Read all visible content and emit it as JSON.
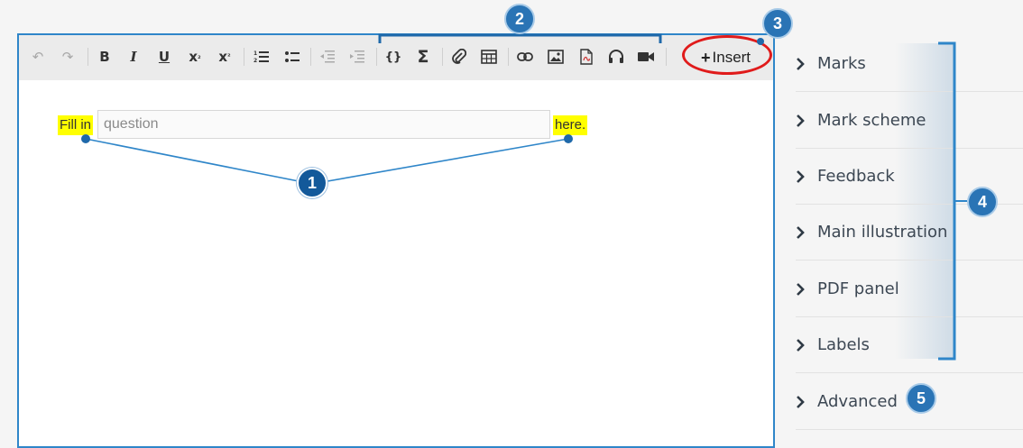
{
  "toolbar": {
    "items": [
      {
        "icon": "undo-icon",
        "glyph": "↶",
        "dim": true
      },
      {
        "icon": "redo-icon",
        "glyph": "↷",
        "dim": true
      },
      {
        "icon": "bold-icon",
        "glyph": "B"
      },
      {
        "icon": "italic-icon",
        "glyph": "I"
      },
      {
        "icon": "underline-icon",
        "glyph": "U"
      },
      {
        "icon": "subscript-icon",
        "glyph": "x₂"
      },
      {
        "icon": "superscript-icon",
        "glyph": "x²"
      },
      {
        "icon": "numbered-list-icon",
        "glyph": "⒈"
      },
      {
        "icon": "bullet-list-icon",
        "glyph": "•≡"
      },
      {
        "icon": "outdent-icon",
        "glyph": "⇤",
        "dim": true
      },
      {
        "icon": "indent-icon",
        "glyph": "⇥",
        "dim": true
      },
      {
        "icon": "code-braces-icon",
        "glyph": "{}"
      },
      {
        "icon": "sigma-icon",
        "glyph": "Σ"
      },
      {
        "icon": "paperclip-icon",
        "glyph": "📎"
      },
      {
        "icon": "table-icon",
        "glyph": "▦"
      },
      {
        "icon": "link-icon",
        "glyph": "⊂⊃"
      },
      {
        "icon": "image-icon",
        "glyph": "▨"
      },
      {
        "icon": "pdf-icon",
        "glyph": "▤"
      },
      {
        "icon": "headphones-icon",
        "glyph": "∩"
      },
      {
        "icon": "video-icon",
        "glyph": "■"
      }
    ],
    "insert_label": "Insert"
  },
  "content": {
    "before_text": "Fill in",
    "input_placeholder": "question",
    "after_text": "here."
  },
  "sections": [
    {
      "label": "Marks"
    },
    {
      "label": "Mark scheme"
    },
    {
      "label": "Feedback"
    },
    {
      "label": "Main illustration"
    },
    {
      "label": "PDF panel"
    },
    {
      "label": "Labels"
    },
    {
      "label": "Advanced"
    }
  ],
  "callouts": [
    "1",
    "2",
    "3",
    "4",
    "5"
  ],
  "colors": {
    "accent": "#2f86c9",
    "highlight": "#ffff00",
    "insert_ring": "#e01b1b",
    "callout": "#2a74b5"
  }
}
